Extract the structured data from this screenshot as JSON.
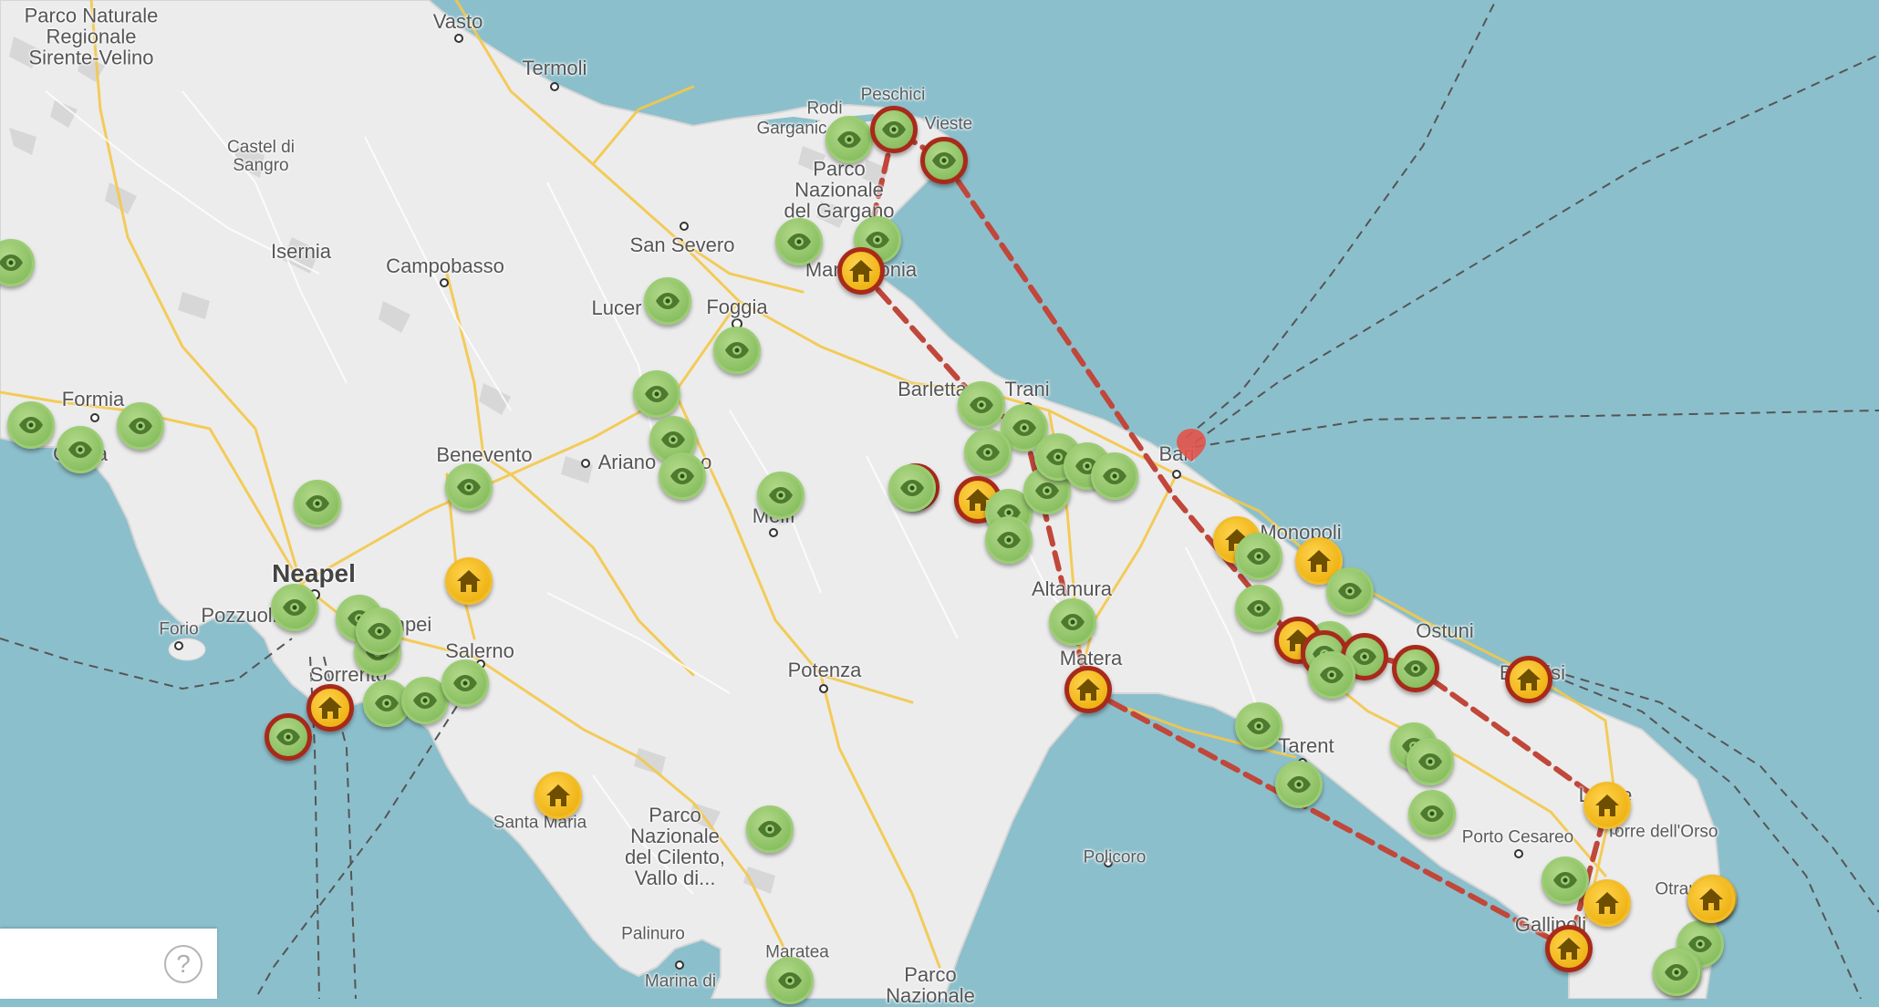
{
  "map": {
    "labels": [
      {
        "id": "parco-sirente",
        "text": "Parco Naturale\nRegionale\nSirente-Velino"
      },
      {
        "id": "vasto",
        "text": "Vasto"
      },
      {
        "id": "termoli",
        "text": "Termoli"
      },
      {
        "id": "castel-di-sangro",
        "text": "Castel di\nSangro"
      },
      {
        "id": "isernia",
        "text": "Isernia"
      },
      {
        "id": "campobasso",
        "text": "Campobasso"
      },
      {
        "id": "san-severo",
        "text": "San Severo"
      },
      {
        "id": "lucera",
        "text": "Lucer"
      },
      {
        "id": "foggia",
        "text": "Foggia"
      },
      {
        "id": "rodi",
        "text": "Rodi"
      },
      {
        "id": "rodi-garganico",
        "text": "Garganic"
      },
      {
        "id": "peschici",
        "text": "Peschici"
      },
      {
        "id": "vieste",
        "text": "Vieste"
      },
      {
        "id": "parco-gargano",
        "text": "Parco\nNazionale\ndel Gargano"
      },
      {
        "id": "manfredonia",
        "text": "Manfredonia"
      },
      {
        "id": "formia",
        "text": "Formia"
      },
      {
        "id": "gaeta",
        "text": "Gaeta"
      },
      {
        "id": "benevento",
        "text": "Benevento"
      },
      {
        "id": "ariano",
        "text": "Ariano Irpino"
      },
      {
        "id": "melfi",
        "text": "Melfi"
      },
      {
        "id": "barletta",
        "text": "Barletta"
      },
      {
        "id": "trani",
        "text": "Trani"
      },
      {
        "id": "bari",
        "text": "Bari"
      },
      {
        "id": "monopoli",
        "text": "Monopoli"
      },
      {
        "id": "altamura",
        "text": "Altamura"
      },
      {
        "id": "matera",
        "text": "Matera"
      },
      {
        "id": "ostuni",
        "text": "Ostuni"
      },
      {
        "id": "brindisi",
        "text": "Brindisi"
      },
      {
        "id": "neapel",
        "text": "Neapel"
      },
      {
        "id": "pozzuoli",
        "text": "Pozzuoli"
      },
      {
        "id": "pompei",
        "text": "Pompei"
      },
      {
        "id": "forio",
        "text": "Forio"
      },
      {
        "id": "salerno",
        "text": "Salerno"
      },
      {
        "id": "sorrento",
        "text": "Sorrento"
      },
      {
        "id": "potenza",
        "text": "Potenza"
      },
      {
        "id": "tarent",
        "text": "Tarent"
      },
      {
        "id": "lecce",
        "text": "Lecce"
      },
      {
        "id": "porto-cesareo",
        "text": "Porto Cesareo"
      },
      {
        "id": "torre-dellorso",
        "text": "Torre dell'Orso"
      },
      {
        "id": "otranto",
        "text": "Otranto"
      },
      {
        "id": "gallipoli",
        "text": "Gallipoli"
      },
      {
        "id": "policoro",
        "text": "Policoro"
      },
      {
        "id": "santa-maria",
        "text": "Santa Maria"
      },
      {
        "id": "parco-cilento",
        "text": "Parco\nNazionale\ndel Cilento,\nVallo di..."
      },
      {
        "id": "palinuro",
        "text": "Palinuro"
      },
      {
        "id": "maratea",
        "text": "Maratea"
      },
      {
        "id": "marina-di",
        "text": "Marina di"
      },
      {
        "id": "parco-nazionale-s",
        "text": "Parco\nNazionale"
      }
    ],
    "markers": [
      {
        "type": "sight",
        "route": false
      },
      {
        "type": "sight",
        "route": false
      },
      {
        "type": "sight",
        "route": false
      },
      {
        "type": "sight",
        "route": false
      },
      {
        "type": "sight",
        "route": false
      },
      {
        "type": "sight",
        "route": true
      },
      {
        "type": "sight",
        "route": true
      },
      {
        "type": "sight",
        "route": false
      },
      {
        "type": "sight",
        "route": false
      },
      {
        "type": "home",
        "route": true
      },
      {
        "type": "sight",
        "route": false
      },
      {
        "type": "sight",
        "route": false
      },
      {
        "type": "sight",
        "route": false
      },
      {
        "type": "sight",
        "route": false
      },
      {
        "type": "sight",
        "route": false
      },
      {
        "type": "sight",
        "route": false
      },
      {
        "type": "sight",
        "route": false
      },
      {
        "type": "sight",
        "route": false
      },
      {
        "type": "sight",
        "route": true
      },
      {
        "type": "home",
        "route": true
      },
      {
        "type": "sight",
        "route": false
      },
      {
        "type": "sight",
        "route": false
      },
      {
        "type": "sight",
        "route": false
      },
      {
        "type": "sight",
        "route": false
      },
      {
        "type": "sight",
        "route": false
      },
      {
        "type": "sight",
        "route": false
      },
      {
        "type": "sight",
        "route": false
      },
      {
        "type": "sight",
        "route": false
      },
      {
        "type": "home",
        "route": true
      },
      {
        "type": "home",
        "route": false
      },
      {
        "type": "sight",
        "route": false
      },
      {
        "type": "home",
        "route": false
      },
      {
        "type": "sight",
        "route": false
      },
      {
        "type": "sight",
        "route": false
      },
      {
        "type": "sight",
        "route": false
      },
      {
        "type": "home",
        "route": true
      },
      {
        "type": "sight",
        "route": true
      },
      {
        "type": "sight",
        "route": true
      },
      {
        "type": "sight",
        "route": false
      },
      {
        "type": "sight",
        "route": true
      },
      {
        "type": "sight",
        "route": false
      },
      {
        "type": "sight",
        "route": false
      },
      {
        "type": "home",
        "route": true
      },
      {
        "type": "home",
        "route": false
      },
      {
        "type": "sight",
        "route": false
      },
      {
        "type": "sight",
        "route": false
      },
      {
        "type": "sight",
        "route": false
      },
      {
        "type": "sight",
        "route": false
      },
      {
        "type": "home",
        "route": false
      },
      {
        "type": "home",
        "route": true
      },
      {
        "type": "home",
        "route": false
      },
      {
        "type": "sight",
        "route": false
      },
      {
        "type": "sight",
        "route": false
      },
      {
        "type": "sight",
        "route": false
      },
      {
        "type": "sight",
        "route": false
      },
      {
        "type": "sight",
        "route": false
      },
      {
        "type": "home",
        "route": false
      },
      {
        "type": "sight",
        "route": false
      },
      {
        "type": "sight",
        "route": false
      },
      {
        "type": "sight",
        "route": false
      },
      {
        "type": "sight",
        "route": false
      },
      {
        "type": "sight",
        "route": false
      },
      {
        "type": "home",
        "route": true
      },
      {
        "type": "sight",
        "route": false
      },
      {
        "type": "sight",
        "route": false
      },
      {
        "type": "sight",
        "route": true
      },
      {
        "type": "home",
        "route": false
      },
      {
        "type": "sight",
        "route": false
      },
      {
        "type": "sight",
        "route": false
      },
      {
        "type": "sight",
        "route": false
      },
      {
        "type": "home",
        "route": false
      },
      {
        "type": "home",
        "route": false
      }
    ]
  },
  "help": {
    "label": "?"
  }
}
